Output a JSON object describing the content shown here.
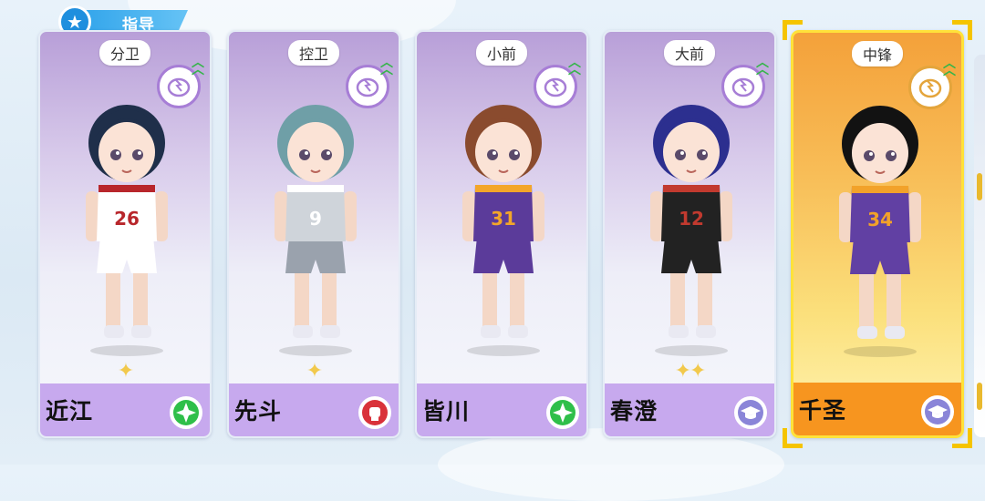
{
  "header": {
    "title": "指导",
    "icon": "star-icon"
  },
  "cards": [
    {
      "position": "分卫",
      "name": "近江",
      "stars": "✦",
      "jersey": "26",
      "selected": false,
      "hair": "#1f2f4a",
      "shirt": "#ffffff",
      "trim": "#b8262b",
      "shorts": "#ffffff",
      "type_icon": "green-star-icon",
      "type_color": "#2fbf4a"
    },
    {
      "position": "控卫",
      "name": "先斗",
      "stars": "✦",
      "jersey": "9",
      "selected": false,
      "hair": "#6f9fa7",
      "shirt": "#cfd4da",
      "trim": "#ffffff",
      "shorts": "#9aa2ad",
      "type_icon": "red-fist-icon",
      "type_color": "#d9323a"
    },
    {
      "position": "小前",
      "name": "皆川",
      "stars": "",
      "jersey": "31",
      "selected": false,
      "hair": "#8a4b2e",
      "shirt": "#5b3b9a",
      "trim": "#f3a629",
      "shorts": "#5b3b9a",
      "type_icon": "green-star-icon",
      "type_color": "#2fbf4a"
    },
    {
      "position": "大前",
      "name": "春澄",
      "stars": "✦✦",
      "jersey": "12",
      "selected": false,
      "hair": "#2c2f8f",
      "shirt": "#222222",
      "trim": "#c23a2f",
      "shorts": "#222222",
      "type_icon": "graduation-cap-icon",
      "type_color": "#8a85d8"
    },
    {
      "position": "中锋",
      "name": "千圣",
      "stars": "",
      "jersey": "34",
      "selected": true,
      "hair": "#121212",
      "shirt": "#6140a3",
      "trim": "#f2a22a",
      "shorts": "#6140a3",
      "type_icon": "graduation-cap-icon",
      "type_color": "#8a85d8"
    }
  ]
}
